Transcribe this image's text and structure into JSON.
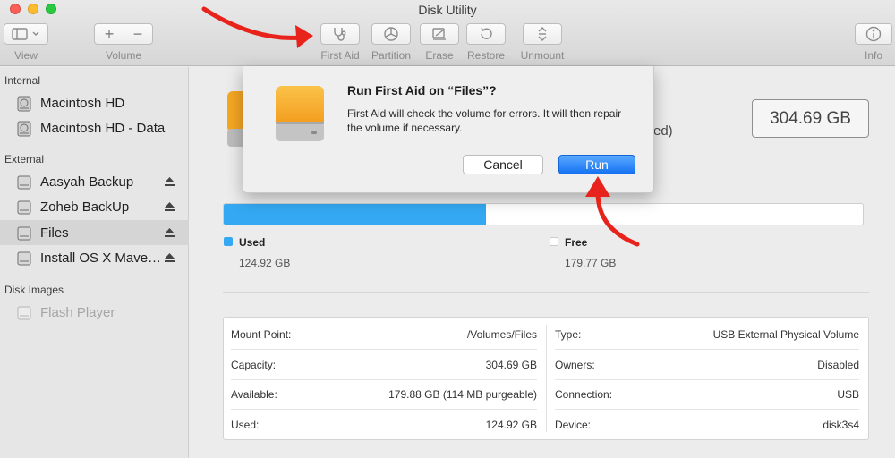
{
  "window": {
    "title": "Disk Utility"
  },
  "toolbar": {
    "view_label": "View",
    "volume_label": "Volume",
    "first_aid_label": "First Aid",
    "partition_label": "Partition",
    "erase_label": "Erase",
    "restore_label": "Restore",
    "unmount_label": "Unmount",
    "info_label": "Info",
    "add_glyph": "+",
    "remove_glyph": "−"
  },
  "sidebar": {
    "sections": [
      {
        "title": "Internal",
        "items": [
          {
            "label": "Macintosh HD"
          },
          {
            "label": "Macintosh HD - Data"
          }
        ]
      },
      {
        "title": "External",
        "items": [
          {
            "label": "Aasyah Backup"
          },
          {
            "label": "Zoheb BackUp"
          },
          {
            "label": "Files",
            "selected": true
          },
          {
            "label": "Install OS X Mave…"
          }
        ]
      },
      {
        "title": "Disk Images",
        "items": [
          {
            "label": "Flash Player",
            "disabled": true
          }
        ]
      }
    ]
  },
  "volume": {
    "capacity_badge": "304.69 GB",
    "hidden_text_fragment": "ed)",
    "usage": {
      "used_fraction": 0.41,
      "used_label": "Used",
      "used_value": "124.92 GB",
      "free_label": "Free",
      "free_value": "179.77 GB",
      "used_color": "#34a8f2",
      "free_color": "#ffffff"
    },
    "info_left": [
      {
        "label": "Mount Point:",
        "value": "/Volumes/Files"
      },
      {
        "label": "Capacity:",
        "value": "304.69 GB"
      },
      {
        "label": "Available:",
        "value": "179.88 GB (114 MB purgeable)"
      },
      {
        "label": "Used:",
        "value": "124.92 GB"
      }
    ],
    "info_right": [
      {
        "label": "Type:",
        "value": "USB External Physical Volume"
      },
      {
        "label": "Owners:",
        "value": "Disabled"
      },
      {
        "label": "Connection:",
        "value": "USB"
      },
      {
        "label": "Device:",
        "value": "disk3s4"
      }
    ]
  },
  "dialog": {
    "title": "Run First Aid on “Files”?",
    "message": "First Aid will check the volume for errors. It will then repair the volume if necessary.",
    "cancel_label": "Cancel",
    "run_label": "Run"
  },
  "colors": {
    "accent": "#1672f2",
    "annotation_arrow": "#e8231b",
    "drive_orange": "#f5a623"
  },
  "icons": {
    "sidebar_drive": "hard-drive-icon",
    "eject": "eject-icon",
    "first_aid": "stethoscope-icon"
  }
}
